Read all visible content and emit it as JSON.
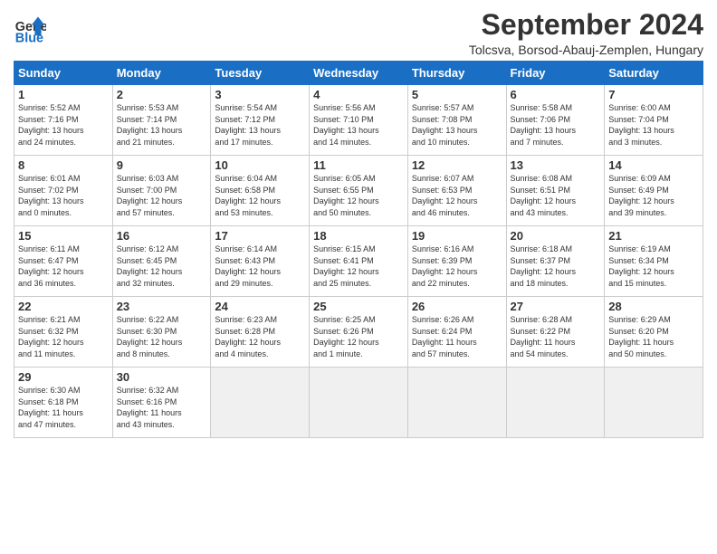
{
  "header": {
    "logo_line1": "General",
    "logo_line2": "Blue",
    "month_title": "September 2024",
    "location": "Tolcsva, Borsod-Abauj-Zemplen, Hungary"
  },
  "days_of_week": [
    "Sunday",
    "Monday",
    "Tuesday",
    "Wednesday",
    "Thursday",
    "Friday",
    "Saturday"
  ],
  "weeks": [
    [
      {
        "day": "1",
        "sunrise": "5:52 AM",
        "sunset": "7:16 PM",
        "daylight": "13 hours and 24 minutes."
      },
      {
        "day": "2",
        "sunrise": "5:53 AM",
        "sunset": "7:14 PM",
        "daylight": "13 hours and 21 minutes."
      },
      {
        "day": "3",
        "sunrise": "5:54 AM",
        "sunset": "7:12 PM",
        "daylight": "13 hours and 17 minutes."
      },
      {
        "day": "4",
        "sunrise": "5:56 AM",
        "sunset": "7:10 PM",
        "daylight": "13 hours and 14 minutes."
      },
      {
        "day": "5",
        "sunrise": "5:57 AM",
        "sunset": "7:08 PM",
        "daylight": "13 hours and 10 minutes."
      },
      {
        "day": "6",
        "sunrise": "5:58 AM",
        "sunset": "7:06 PM",
        "daylight": "13 hours and 7 minutes."
      },
      {
        "day": "7",
        "sunrise": "6:00 AM",
        "sunset": "7:04 PM",
        "daylight": "13 hours and 3 minutes."
      }
    ],
    [
      {
        "day": "8",
        "sunrise": "6:01 AM",
        "sunset": "7:02 PM",
        "daylight": "13 hours and 0 minutes."
      },
      {
        "day": "9",
        "sunrise": "6:03 AM",
        "sunset": "7:00 PM",
        "daylight": "12 hours and 57 minutes."
      },
      {
        "day": "10",
        "sunrise": "6:04 AM",
        "sunset": "6:58 PM",
        "daylight": "12 hours and 53 minutes."
      },
      {
        "day": "11",
        "sunrise": "6:05 AM",
        "sunset": "6:55 PM",
        "daylight": "12 hours and 50 minutes."
      },
      {
        "day": "12",
        "sunrise": "6:07 AM",
        "sunset": "6:53 PM",
        "daylight": "12 hours and 46 minutes."
      },
      {
        "day": "13",
        "sunrise": "6:08 AM",
        "sunset": "6:51 PM",
        "daylight": "12 hours and 43 minutes."
      },
      {
        "day": "14",
        "sunrise": "6:09 AM",
        "sunset": "6:49 PM",
        "daylight": "12 hours and 39 minutes."
      }
    ],
    [
      {
        "day": "15",
        "sunrise": "6:11 AM",
        "sunset": "6:47 PM",
        "daylight": "12 hours and 36 minutes."
      },
      {
        "day": "16",
        "sunrise": "6:12 AM",
        "sunset": "6:45 PM",
        "daylight": "12 hours and 32 minutes."
      },
      {
        "day": "17",
        "sunrise": "6:14 AM",
        "sunset": "6:43 PM",
        "daylight": "12 hours and 29 minutes."
      },
      {
        "day": "18",
        "sunrise": "6:15 AM",
        "sunset": "6:41 PM",
        "daylight": "12 hours and 25 minutes."
      },
      {
        "day": "19",
        "sunrise": "6:16 AM",
        "sunset": "6:39 PM",
        "daylight": "12 hours and 22 minutes."
      },
      {
        "day": "20",
        "sunrise": "6:18 AM",
        "sunset": "6:37 PM",
        "daylight": "12 hours and 18 minutes."
      },
      {
        "day": "21",
        "sunrise": "6:19 AM",
        "sunset": "6:34 PM",
        "daylight": "12 hours and 15 minutes."
      }
    ],
    [
      {
        "day": "22",
        "sunrise": "6:21 AM",
        "sunset": "6:32 PM",
        "daylight": "12 hours and 11 minutes."
      },
      {
        "day": "23",
        "sunrise": "6:22 AM",
        "sunset": "6:30 PM",
        "daylight": "12 hours and 8 minutes."
      },
      {
        "day": "24",
        "sunrise": "6:23 AM",
        "sunset": "6:28 PM",
        "daylight": "12 hours and 4 minutes."
      },
      {
        "day": "25",
        "sunrise": "6:25 AM",
        "sunset": "6:26 PM",
        "daylight": "12 hours and 1 minute."
      },
      {
        "day": "26",
        "sunrise": "6:26 AM",
        "sunset": "6:24 PM",
        "daylight": "11 hours and 57 minutes."
      },
      {
        "day": "27",
        "sunrise": "6:28 AM",
        "sunset": "6:22 PM",
        "daylight": "11 hours and 54 minutes."
      },
      {
        "day": "28",
        "sunrise": "6:29 AM",
        "sunset": "6:20 PM",
        "daylight": "11 hours and 50 minutes."
      }
    ],
    [
      {
        "day": "29",
        "sunrise": "6:30 AM",
        "sunset": "6:18 PM",
        "daylight": "11 hours and 47 minutes."
      },
      {
        "day": "30",
        "sunrise": "6:32 AM",
        "sunset": "6:16 PM",
        "daylight": "11 hours and 43 minutes."
      },
      null,
      null,
      null,
      null,
      null
    ]
  ]
}
